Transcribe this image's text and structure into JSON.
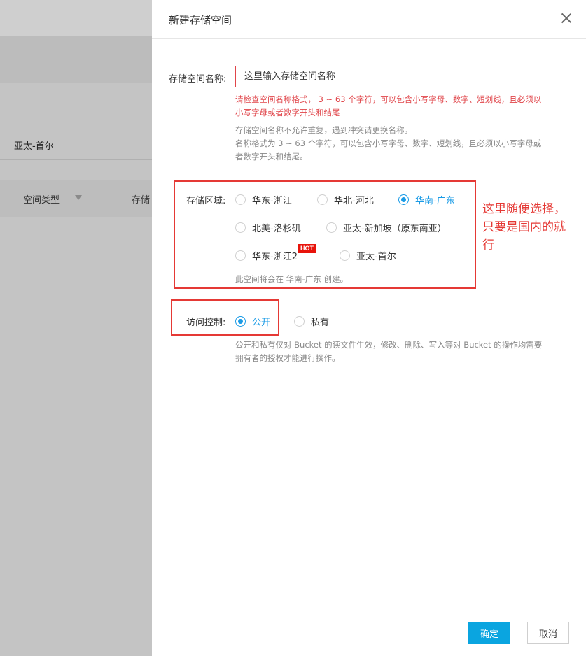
{
  "background": {
    "region_label": "亚太-首尔",
    "table_headers": [
      "空间类型",
      "存储"
    ]
  },
  "dialog": {
    "title": "新建存储空间",
    "name_field": {
      "label": "存储空间名称:",
      "placeholder": "这里输入存储空间名称",
      "error_lines": [
        "请检查空间名称格式， 3 ~ 63 个字符，可以包含小写字母、数字、短划线，且必须以",
        "小写字母或者数字开头和结尾"
      ],
      "help_lines": [
        "存储空间名称不允许重复，遇到冲突请更换名称。",
        "名称格式为 3 ~ 63 个字符，可以包含小写字母、数字、短划线，且必须以小写字母或",
        "者数字开头和结尾。"
      ]
    },
    "region": {
      "label": "存储区域:",
      "options": [
        "华东-浙江",
        "华北-河北",
        "华南-广东",
        "北美-洛杉矶",
        "亚太-新加坡（原东南亚）",
        "华东-浙江2",
        "亚太-首尔"
      ],
      "selected": "华南-广东",
      "hot_badge": "HOT",
      "note": "此空间将会在 华南-广东 创建。"
    },
    "access": {
      "label": "访问控制:",
      "options": [
        "公开",
        "私有"
      ],
      "selected": "公开",
      "help_lines": [
        "公开和私有仅对 Bucket 的读文件生效，修改、删除、写入等对 Bucket 的操作均需要",
        "拥有者的授权才能进行操作。"
      ]
    },
    "buttons": {
      "ok": "确定",
      "cancel": "取消"
    }
  },
  "annotation": {
    "lines": [
      "这里随便选择，",
      "只要是国内的就",
      "行"
    ],
    "color": "#e53935"
  },
  "colors": {
    "accent": "#1a9be6",
    "primary_button": "#0aa5e0",
    "error": "#e0454a"
  }
}
